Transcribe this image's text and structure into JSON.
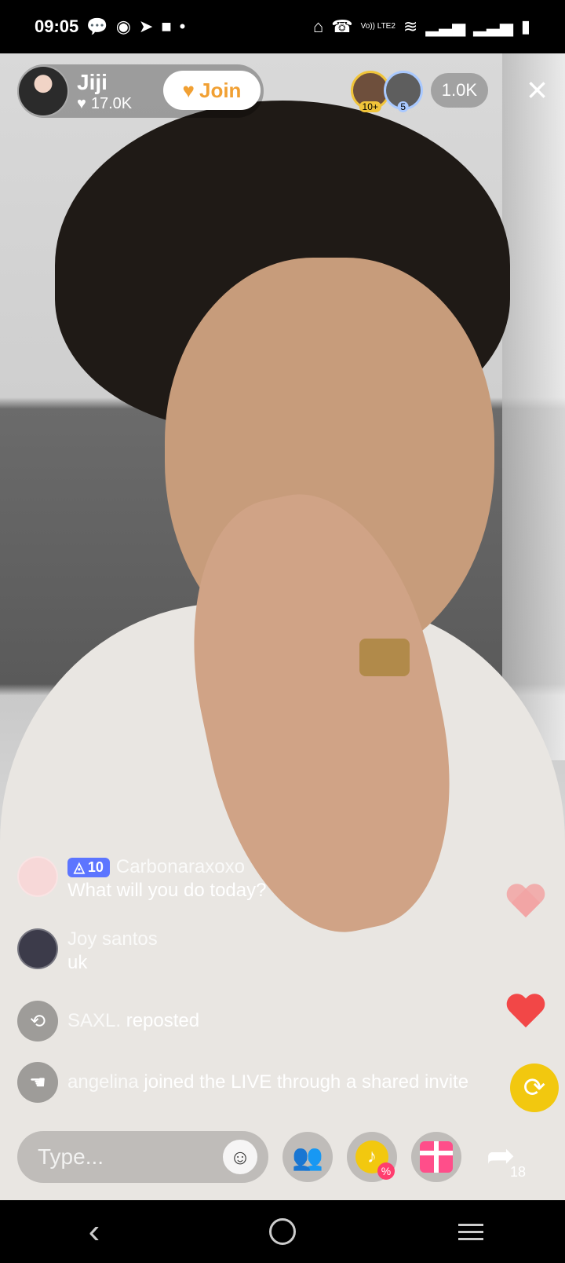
{
  "status_bar": {
    "time": "09:05",
    "left_icons": [
      "chat-icon",
      "messenger-icon",
      "telegram-icon",
      "video-icon",
      "dot-icon"
    ],
    "right_icons": [
      "cast-icon",
      "wifi-calling-icon",
      "volte-icon",
      "wifi-icon",
      "signal-icon",
      "signal-icon",
      "battery-icon"
    ],
    "volte_label": "Vo)) LTE2"
  },
  "header": {
    "host_name": "Jiji",
    "host_likes": "17.0K",
    "join_label": "Join",
    "viewer_badges": [
      "10+",
      "5"
    ],
    "viewer_count": "1.0K",
    "close_icon": "close-icon"
  },
  "chat": {
    "messages": [
      {
        "level": "10",
        "username": "Carbonaraxoxo",
        "text": "What will you do today?"
      },
      {
        "username": "Joy santos",
        "text": "uk"
      }
    ],
    "events": [
      {
        "user": "SAXL.",
        "text": "reposted"
      },
      {
        "user": "angelina",
        "text": "joined the LIVE through a shared invite"
      }
    ]
  },
  "bottom_bar": {
    "type_placeholder": "Type...",
    "share_count": "18"
  },
  "colors": {
    "join_text": "#f1a033",
    "heart": "#f24747",
    "repost_fab": "#f2c80f",
    "level_badge": "#5c75ff",
    "gift": "#ff4e8a"
  }
}
